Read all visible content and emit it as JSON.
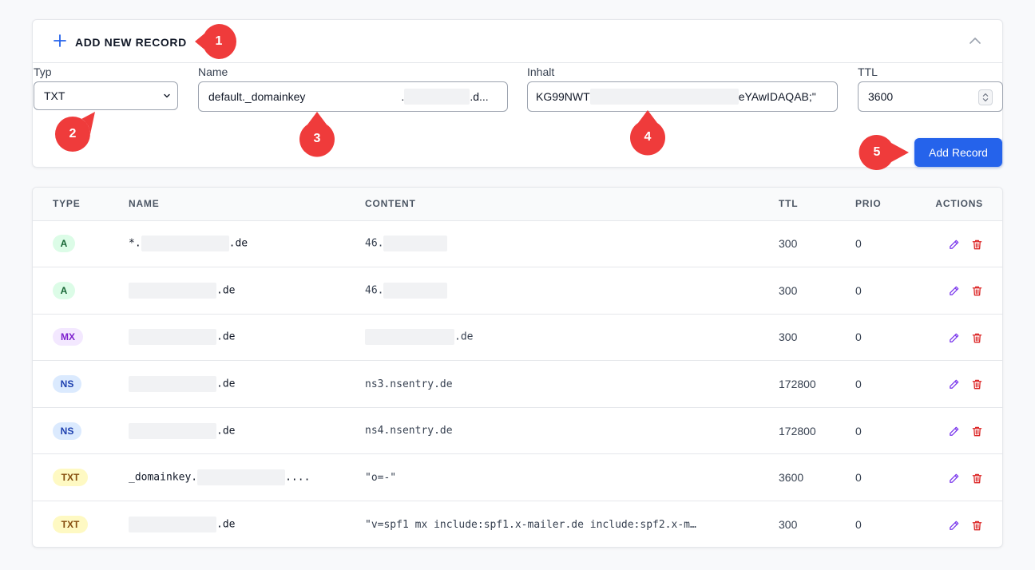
{
  "colors": {
    "accent": "#2563eb",
    "marker": "#ef3b3b",
    "edit": "#7c3aed",
    "delete": "#dc2626"
  },
  "add_form": {
    "title": "ADD NEW RECORD",
    "plus_icon": "plus-icon",
    "collapse_icon": "chevron-up-icon",
    "labels": {
      "type": "Typ",
      "name": "Name",
      "content": "Inhalt",
      "ttl": "TTL"
    },
    "type_value": "TXT",
    "name_value_start": "default._domainkey",
    "name_value_dot": ".",
    "name_value_end": ".d...",
    "content_value_start": "KG99NWT",
    "content_value_end": "eYAwIDAQAB;\"",
    "ttl_value": "3600",
    "submit_label": "Add Record"
  },
  "markers": [
    "1",
    "2",
    "3",
    "4",
    "5"
  ],
  "table": {
    "headers": [
      "TYPE",
      "NAME",
      "CONTENT",
      "TTL",
      "PRIO",
      "ACTIONS"
    ],
    "rows": [
      {
        "type": "A",
        "name_prefix": "*.",
        "name_suffix": ".de",
        "content_prefix": "46.",
        "content_suffix": "",
        "ttl": "300",
        "prio": "0"
      },
      {
        "type": "A",
        "name_prefix": "",
        "name_suffix": ".de",
        "content_prefix": "46.",
        "content_suffix": "",
        "ttl": "300",
        "prio": "0"
      },
      {
        "type": "MX",
        "name_prefix": "",
        "name_suffix": ".de",
        "content_prefix": "",
        "content_suffix": ".de",
        "ttl": "300",
        "prio": "0"
      },
      {
        "type": "NS",
        "name_prefix": "",
        "name_suffix": ".de",
        "content_prefix": "ns3.nsentry.de",
        "content_suffix": "",
        "ttl": "172800",
        "prio": "0"
      },
      {
        "type": "NS",
        "name_prefix": "",
        "name_suffix": ".de",
        "content_prefix": "ns4.nsentry.de",
        "content_suffix": "",
        "ttl": "172800",
        "prio": "0"
      },
      {
        "type": "TXT",
        "name_prefix": "_domainkey.",
        "name_suffix": "....",
        "content_prefix": "\"o=-\"",
        "content_suffix": "",
        "ttl": "3600",
        "prio": "0"
      },
      {
        "type": "TXT",
        "name_prefix": "",
        "name_suffix": ".de",
        "content_prefix": "\"v=spf1 mx include:spf1.x-mailer.de include:spf2.x-m…",
        "content_suffix": "",
        "ttl": "300",
        "prio": "0"
      }
    ],
    "edit_icon": "pencil-icon",
    "delete_icon": "trash-icon"
  }
}
